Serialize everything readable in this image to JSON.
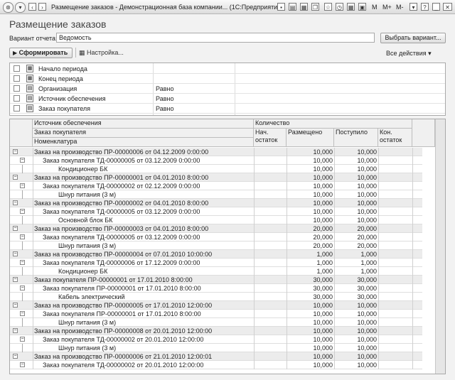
{
  "window": {
    "title": "Размещение заказов - Демонстрационная база компании...  (1С:Предприятие)",
    "memory_buttons": [
      "M",
      "M+",
      "M-"
    ]
  },
  "form": {
    "title": "Размещение заказов",
    "variant_label": "Вариант отчета:",
    "variant_value": "Ведомость",
    "choose_variant_button": "Выбрать вариант...",
    "generate_button": "Сформировать",
    "settings_link": "Настройка...",
    "all_actions": "Все действия ▾"
  },
  "filters": [
    {
      "name": "Начало периода",
      "condition": ""
    },
    {
      "name": "Конец периода",
      "condition": ""
    },
    {
      "name": "Организация",
      "condition": "Равно"
    },
    {
      "name": "Источник обеспечения",
      "condition": "Равно"
    },
    {
      "name": "Заказ покупателя",
      "condition": "Равно"
    }
  ],
  "report": {
    "header": {
      "group1": "Источник обеспечения",
      "group2": "Заказ покупателя",
      "group3": "Номенклатура",
      "quantity": "Количество",
      "col_start": "Нач. остаток",
      "col_placed": "Размещено",
      "col_received": "Поступило",
      "col_end": "Кон. остаток"
    },
    "rows": [
      {
        "level": 0,
        "text": "Заказ на производство ПР-00000006 от 04.12.2009 0:00:00",
        "placed": "10,000",
        "received": "10,000"
      },
      {
        "level": 1,
        "text": "Заказ покупателя ТД-00000005 от 03.12.2009 0:00:00",
        "placed": "10,000",
        "received": "10,000"
      },
      {
        "level": 2,
        "text": "Кондиционер БК",
        "placed": "10,000",
        "received": "10,000"
      },
      {
        "level": 0,
        "text": "Заказ на производство ПР-00000001 от 04.01.2010 8:00:00",
        "placed": "10,000",
        "received": "10,000"
      },
      {
        "level": 1,
        "text": "Заказ покупателя ТД-00000002 от 02.12.2009 0:00:00",
        "placed": "10,000",
        "received": "10,000"
      },
      {
        "level": 2,
        "text": "Шнур питания (3 м)",
        "placed": "10,000",
        "received": "10,000"
      },
      {
        "level": 0,
        "text": "Заказ на производство ПР-00000002 от 04.01.2010 8:00:00",
        "placed": "10,000",
        "received": "10,000"
      },
      {
        "level": 1,
        "text": "Заказ покупателя ТД-00000005 от 03.12.2009 0:00:00",
        "placed": "10,000",
        "received": "10,000"
      },
      {
        "level": 2,
        "text": "Основной блок БК",
        "placed": "10,000",
        "received": "10,000"
      },
      {
        "level": 0,
        "text": "Заказ на производство ПР-00000003 от 04.01.2010 8:00:00",
        "placed": "20,000",
        "received": "20,000"
      },
      {
        "level": 1,
        "text": "Заказ покупателя ТД-00000005 от 03.12.2009 0:00:00",
        "placed": "20,000",
        "received": "20,000"
      },
      {
        "level": 2,
        "text": "Шнур питания (3 м)",
        "placed": "20,000",
        "received": "20,000"
      },
      {
        "level": 0,
        "text": "Заказ на производство ПР-00000004 от 07.01.2010 10:00:00",
        "placed": "1,000",
        "received": "1,000"
      },
      {
        "level": 1,
        "text": "Заказ покупателя ТД-00000006 от 17.12.2009 0:00:00",
        "placed": "1,000",
        "received": "1,000"
      },
      {
        "level": 2,
        "text": "Кондиционер БК",
        "placed": "1,000",
        "received": "1,000"
      },
      {
        "level": 0,
        "text": "Заказ покупателя ПР-00000001 от 17.01.2010 8:00:00",
        "placed": "30,000",
        "received": "30,000"
      },
      {
        "level": 1,
        "text": "Заказ покупателя ПР-00000001 от 17.01.2010 8:00:00",
        "placed": "30,000",
        "received": "30,000"
      },
      {
        "level": 2,
        "text": "Кабель электрический",
        "placed": "30,000",
        "received": "30,000"
      },
      {
        "level": 0,
        "text": "Заказ на производство ПР-00000005 от 17.01.2010 12:00:00",
        "placed": "10,000",
        "received": "10,000"
      },
      {
        "level": 1,
        "text": "Заказ покупателя ПР-00000001 от 17.01.2010 8:00:00",
        "placed": "10,000",
        "received": "10,000"
      },
      {
        "level": 2,
        "text": "Шнур питания (3 м)",
        "placed": "10,000",
        "received": "10,000"
      },
      {
        "level": 0,
        "text": "Заказ на производство ПР-00000008 от 20.01.2010 12:00:00",
        "placed": "10,000",
        "received": "10,000"
      },
      {
        "level": 1,
        "text": "Заказ покупателя ТД-00000002 от 20.01.2010 12:00:00",
        "placed": "10,000",
        "received": "10,000"
      },
      {
        "level": 2,
        "text": "Шнур питания (3 м)",
        "placed": "10,000",
        "received": "10,000"
      },
      {
        "level": 0,
        "text": "Заказ на производство ПР-00000006 от 21.01.2010 12:00:01",
        "placed": "10,000",
        "received": "10,000"
      },
      {
        "level": 1,
        "text": "Заказ покупателя ТД-00000002 от 20.01.2010 12:00:00",
        "placed": "10,000",
        "received": "10,000"
      }
    ]
  }
}
